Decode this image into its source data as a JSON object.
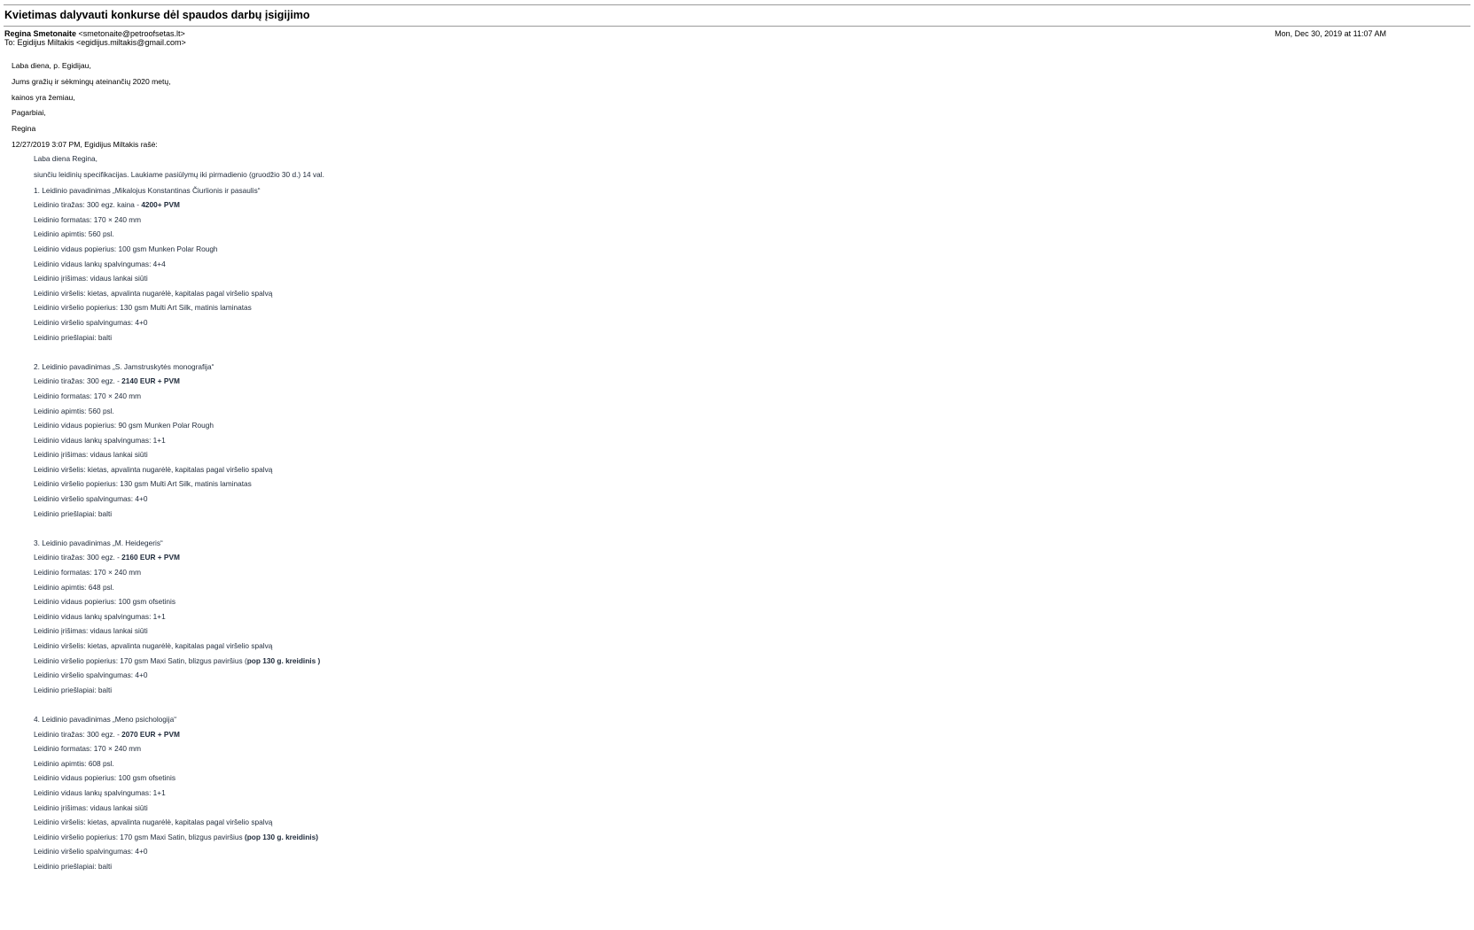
{
  "email": {
    "subject": "Kvietimas dalyvauti konkurse dėl spaudos darbų įsigijimo",
    "from_name": "Regina Smetonaite",
    "from_email": "<smetonaite@petroofsetas.lt>",
    "to": "To: Egidijus Miltakis <egidijus.miltakis@gmail.com>",
    "date": "Mon, Dec 30, 2019 at 11:07 AM"
  },
  "reply": {
    "lines": [
      "Laba diena, p. Egidijau,",
      "Jums gražių ir sėkmingų ateinančių 2020 metų,",
      "kainos yra žemiau,",
      "Pagarbiai,",
      "Regina",
      "12/27/2019 3:07 PM, Egidijus Miltakis rašė:"
    ]
  },
  "quoted": {
    "greeting": "Laba diena Regina,",
    "intro": "siunčiu leidinių specifikacijas. Laukiame pasiūlymų iki pirmadienio (gruodžio 30 d.) 14 val.",
    "items": [
      {
        "title": "1. Leidinio pavadinimas „Mikalojus Konstantinas Čiurlionis ir pasaulis“",
        "tirazas_label": "Leidinio tiražas: 300 egz. kaina - ",
        "tirazas_price": "4200+ PVM",
        "formatas": "Leidinio formatas: 170 × 240 mm",
        "apimtis": "Leidinio apimtis: 560 psl.",
        "popierius": "Leidinio vidaus popierius: 100 gsm Munken Polar Rough",
        "spalvingumas": "Leidinio vidaus lankų spalvingumas: 4+4",
        "irisimas": "Leidinio įrišimas: vidaus lankai siūti",
        "virselis": "Leidinio viršelis: kietas, apvalinta nugarėlė, kapitalas pagal viršelio spalvą",
        "virselio_popierius": "Leidinio viršelio popierius: 130 gsm Multi Art Silk, matinis laminatas",
        "virselio_popierius_extra": "",
        "virselio_spalvingumas": "Leidinio viršelio spalvingumas: 4+0",
        "priesLapiai": "Leidinio priešlapiai: balti"
      },
      {
        "title": "2. Leidinio pavadinimas „S. Jamstruskytės monografija“",
        "tirazas_label": "Leidinio tiražas: 300 egz. - ",
        "tirazas_price": "2140 EUR + PVM",
        "formatas": "Leidinio formatas: 170 × 240 mm",
        "apimtis": "Leidinio apimtis: 560 psl.",
        "popierius": "Leidinio vidaus popierius: 90 gsm Munken Polar Rough",
        "spalvingumas": "Leidinio vidaus lankų spalvingumas: 1+1",
        "irisimas": "Leidinio įrišimas: vidaus lankai siūti",
        "virselis": "Leidinio viršelis: kietas, apvalinta nugarėlė, kapitalas pagal viršelio spalvą",
        "virselio_popierius": "Leidinio viršelio popierius: 130 gsm Multi Art Silk, matinis laminatas",
        "virselio_popierius_extra": "",
        "virselio_spalvingumas": "Leidinio viršelio spalvingumas: 4+0",
        "priesLapiai": "Leidinio priešlapiai: balti"
      },
      {
        "title": "3. Leidinio pavadinimas „M. Heidegeris“",
        "tirazas_label": "Leidinio tiražas: 300 egz. - ",
        "tirazas_price": "2160 EUR + PVM",
        "formatas": "Leidinio formatas: 170 × 240 mm",
        "apimtis": "Leidinio apimtis: 648 psl.",
        "popierius": "Leidinio vidaus popierius: 100 gsm ofsetinis",
        "spalvingumas": "Leidinio vidaus lankų spalvingumas: 1+1",
        "irisimas": "Leidinio įrišimas: vidaus lankai siūti",
        "virselis": "Leidinio viršelis: kietas, apvalinta nugarėlė, kapitalas pagal viršelio spalvą",
        "virselio_popierius": "Leidinio viršelio popierius: 170 gsm Maxi Satin, blizgus paviršius (",
        "virselio_popierius_extra": "pop 130 g. kreidinis )",
        "virselio_spalvingumas": "Leidinio viršelio spalvingumas: 4+0",
        "priesLapiai": "Leidinio priešlapiai: balti"
      },
      {
        "title": "4. Leidinio pavadinimas „Meno psichologija“",
        "tirazas_label": "Leidinio tiražas: 300 egz. - ",
        "tirazas_price": "2070 EUR + PVM",
        "formatas": "Leidinio formatas: 170 × 240 mm",
        "apimtis": "Leidinio apimtis: 608 psl.",
        "popierius": "Leidinio vidaus popierius: 100 gsm ofsetinis",
        "spalvingumas": "Leidinio vidaus lankų spalvingumas: 1+1",
        "irisimas": "Leidinio įrišimas: vidaus lankai siūti",
        "virselis": "Leidinio viršelis: kietas, apvalinta nugarėlė, kapitalas pagal viršelio spalvą",
        "virselio_popierius": "Leidinio viršelio popierius: 170 gsm Maxi Satin, blizgus paviršius ",
        "virselio_popierius_extra": "(pop 130 g. kreidinis)",
        "virselio_spalvingumas": "Leidinio viršelio spalvingumas: 4+0",
        "priesLapiai": "Leidinio priešlapiai: balti"
      }
    ]
  }
}
